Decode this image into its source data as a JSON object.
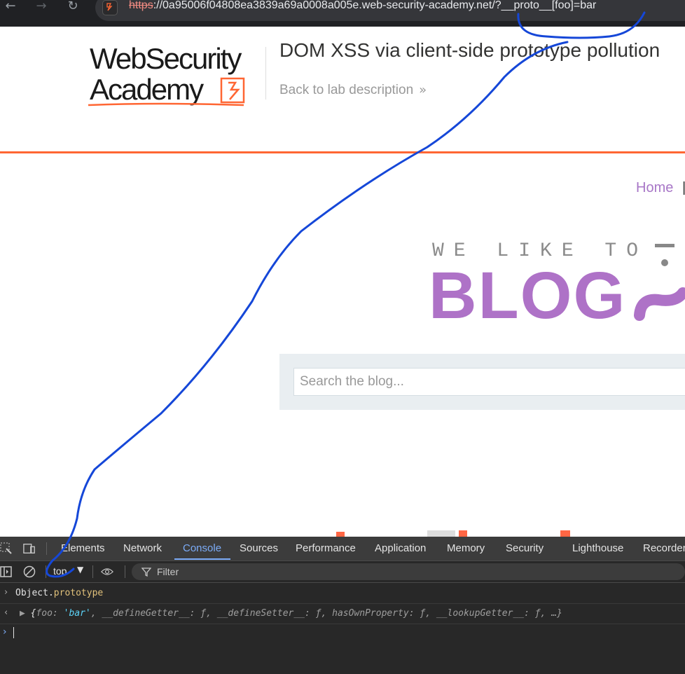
{
  "browser": {
    "url_scheme": "https",
    "url_rest": "://0a95006f04808ea3839a69a0008a005e.web-security-academy.net/?__proto__[foo]=bar",
    "back_glyph": "←",
    "forward_glyph": "→",
    "reload_glyph": "↻"
  },
  "lab_header": {
    "logo_line1": "WebSecurity",
    "logo_line2": "Academy",
    "title": "DOM XSS via client-side prototype pollution",
    "back_link": "Back to lab description",
    "back_chevrons": "»"
  },
  "blog": {
    "nav_home": "Home",
    "nav_separator": "|",
    "banner_small": "WE LIKE TO",
    "banner_big": "BLOG",
    "search_placeholder": "Search the blog...",
    "accent_color": "#ae72c7"
  },
  "devtools": {
    "tabs": [
      "Elements",
      "Network",
      "Console",
      "Sources",
      "Performance",
      "Application",
      "Memory",
      "Security",
      "Lighthouse",
      "Recorder"
    ],
    "active_tab": "Console",
    "context": "top",
    "filter_label": "Filter",
    "console": {
      "input_object": "Object",
      "input_prop": "prototype",
      "output_open": "{",
      "output_key1": "foo",
      "output_val1": "'bar'",
      "output_rest": "__defineGetter__: ƒ, __defineSetter__: ƒ, hasOwnProperty: ƒ, __lookupGetter__: ƒ, …}"
    }
  }
}
